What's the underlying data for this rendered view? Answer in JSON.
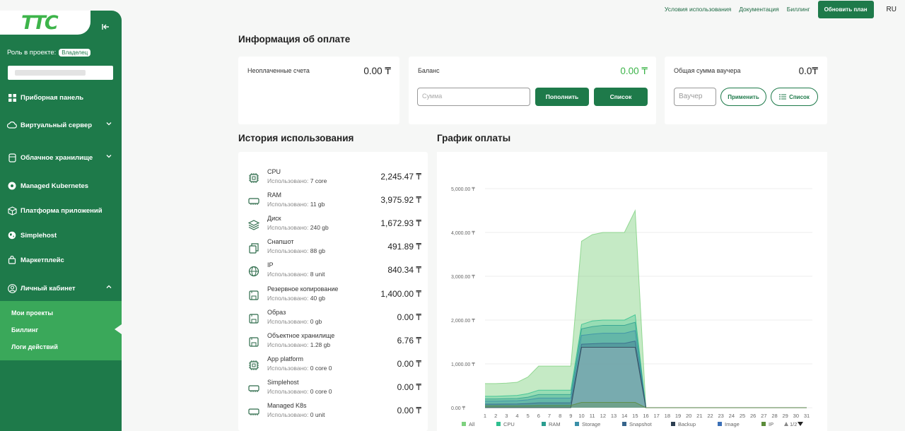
{
  "sidebar": {
    "logo": "ТТС",
    "role_label": "Роль в проекте:",
    "role_value": "Владелец",
    "items": [
      {
        "label": "Приборная панель",
        "icon": "dashboard-icon",
        "chevron": ""
      },
      {
        "label": "Виртуальный сервер",
        "icon": "cloud-icon",
        "chevron": "down"
      },
      {
        "label": "Облачное хранилище",
        "icon": "storage-icon",
        "chevron": "down"
      },
      {
        "label": "Managed Kubernetes",
        "icon": "kubernetes-icon",
        "chevron": ""
      },
      {
        "label": "Платформа приложений",
        "icon": "cube-icon",
        "chevron": ""
      },
      {
        "label": "Simplehost",
        "icon": "globe-icon",
        "chevron": ""
      },
      {
        "label": "Маркетплейс",
        "icon": "bag-icon",
        "chevron": ""
      },
      {
        "label": "Личный кабинет",
        "icon": "user-icon",
        "chevron": "up"
      }
    ],
    "submenu": [
      "Мои проекты",
      "Биллинг",
      "Логи действий"
    ]
  },
  "topbar": {
    "links": [
      "Условия использования",
      "Документация",
      "Биллинг"
    ],
    "upgrade": "Обновить план",
    "lang": "RU"
  },
  "payment": {
    "title": "Информация об оплате",
    "unpaid_label": "Неоплаченные счета",
    "unpaid_value": "0.00 ₸",
    "balance_label": "Баланс",
    "balance_value": "0.00 ₸",
    "amount_placeholder": "Сумма",
    "topup_btn": "Пополнить",
    "list_btn": "Список",
    "voucher_label": "Общая сумма ваучера",
    "voucher_value": "0.0₸",
    "voucher_placeholder": "Ваучер",
    "apply_btn": "Применить",
    "voucher_list_btn": "Список"
  },
  "usage": {
    "title": "История использования",
    "used_prefix": "Использовано:",
    "rows": [
      {
        "name": "CPU",
        "used": "7 core",
        "amount": "2,245.47 ₸",
        "icon": "cpu-icon"
      },
      {
        "name": "RAM",
        "used": "11 gb",
        "amount": "3,975.92 ₸",
        "icon": "ram-icon"
      },
      {
        "name": "Диск",
        "used": "240 gb",
        "amount": "1,672.93 ₸",
        "icon": "layers-icon"
      },
      {
        "name": "Снапшот",
        "used": "88 gb",
        "amount": "491.89 ₸",
        "icon": "copy-icon"
      },
      {
        "name": "IP",
        "used": "8 unit",
        "amount": "840.34 ₸",
        "icon": "globe-icon"
      },
      {
        "name": "Резервное копирование",
        "used": "40 gb",
        "amount": "1,400.00 ₸",
        "icon": "floppy-icon"
      },
      {
        "name": "Образ",
        "used": "0 gb",
        "amount": "0.00 ₸",
        "icon": "floppy-icon"
      },
      {
        "name": "Объектное хранилище",
        "used": "1.28 gb",
        "amount": "6.76 ₸",
        "icon": "floppy-icon"
      },
      {
        "name": "App platform",
        "used": "0 core 0",
        "amount": "0.00 ₸",
        "icon": "cpu-icon"
      },
      {
        "name": "Simplehost",
        "used": "0 core 0",
        "amount": "0.00 ₸",
        "icon": "ram-icon"
      },
      {
        "name": "Managed K8s",
        "used": "0 unit",
        "amount": "0.00 ₸",
        "icon": "ram-icon"
      }
    ]
  },
  "chart_title": "График оплаты",
  "chart_data": {
    "type": "area",
    "x": [
      1,
      2,
      3,
      4,
      5,
      6,
      7,
      8,
      9,
      10,
      11,
      12,
      13,
      14,
      15,
      16,
      17,
      18,
      19,
      20,
      21,
      22,
      23,
      24,
      25,
      26,
      27,
      28,
      29,
      30,
      31
    ],
    "ylim": [
      0,
      5000
    ],
    "yticks": [
      "0.00 ₸",
      "1,000.00 ₸",
      "2,000.00 ₸",
      "3,000.00 ₸",
      "4,000.00 ₸",
      "5,000.00 ₸"
    ],
    "yvalues": [
      0,
      1000,
      2000,
      3000,
      4000,
      5000
    ],
    "series": [
      {
        "name": "All",
        "color": "#7ed17f",
        "values": [
          550,
          550,
          560,
          580,
          700,
          950,
          950,
          950,
          950,
          3800,
          3950,
          4000,
          4000,
          4000,
          4500,
          0,
          0,
          0,
          0,
          0,
          0,
          0,
          0,
          0,
          0,
          0,
          0,
          0,
          0,
          0,
          0
        ]
      },
      {
        "name": "CPU",
        "color": "#2fbf8f",
        "values": [
          260,
          260,
          270,
          280,
          320,
          400,
          400,
          400,
          400,
          1900,
          1980,
          2000,
          2000,
          2000,
          2120,
          0,
          0,
          0,
          0,
          0,
          0,
          0,
          0,
          0,
          0,
          0,
          0,
          0,
          0,
          0,
          0
        ]
      },
      {
        "name": "RAM",
        "color": "#2a9d8f",
        "values": [
          200,
          200,
          205,
          210,
          240,
          300,
          300,
          300,
          300,
          1800,
          1850,
          1880,
          1880,
          1880,
          1950,
          0,
          0,
          0,
          0,
          0,
          0,
          0,
          0,
          0,
          0,
          0,
          0,
          0,
          0,
          0,
          0
        ]
      },
      {
        "name": "Storage",
        "color": "#3a8fa8",
        "values": [
          150,
          150,
          155,
          160,
          180,
          220,
          220,
          220,
          220,
          1650,
          1680,
          1700,
          1700,
          1700,
          1760,
          0,
          0,
          0,
          0,
          0,
          0,
          0,
          0,
          0,
          0,
          0,
          0,
          0,
          0,
          0,
          0
        ]
      },
      {
        "name": "Snapshot",
        "color": "#36648b",
        "values": [
          80,
          80,
          82,
          85,
          95,
          110,
          110,
          110,
          110,
          1450,
          1460,
          1470,
          1470,
          1470,
          1520,
          0,
          0,
          0,
          0,
          0,
          0,
          0,
          0,
          0,
          0,
          0,
          0,
          0,
          0,
          0,
          0
        ]
      },
      {
        "name": "Backup",
        "color": "#2c3e50",
        "values": [
          0,
          0,
          0,
          0,
          0,
          0,
          0,
          0,
          0,
          1380,
          1380,
          1380,
          1380,
          1380,
          1380,
          0,
          0,
          0,
          0,
          0,
          0,
          0,
          0,
          0,
          0,
          0,
          0,
          0,
          0,
          0,
          0
        ]
      },
      {
        "name": "Image",
        "color": "#3b6fb6",
        "values": [
          0,
          0,
          0,
          0,
          0,
          0,
          0,
          0,
          0,
          0,
          0,
          0,
          0,
          0,
          0,
          0,
          0,
          0,
          0,
          0,
          0,
          0,
          0,
          0,
          0,
          0,
          0,
          0,
          0,
          0,
          0
        ]
      },
      {
        "name": "IP",
        "color": "#5b8c3a",
        "values": [
          40,
          40,
          40,
          40,
          45,
          50,
          50,
          50,
          50,
          120,
          120,
          120,
          120,
          120,
          120,
          0,
          0,
          0,
          0,
          0,
          0,
          0,
          0,
          0,
          0,
          0,
          0,
          0,
          0,
          0,
          0
        ]
      }
    ],
    "legend_page": "1/2"
  }
}
